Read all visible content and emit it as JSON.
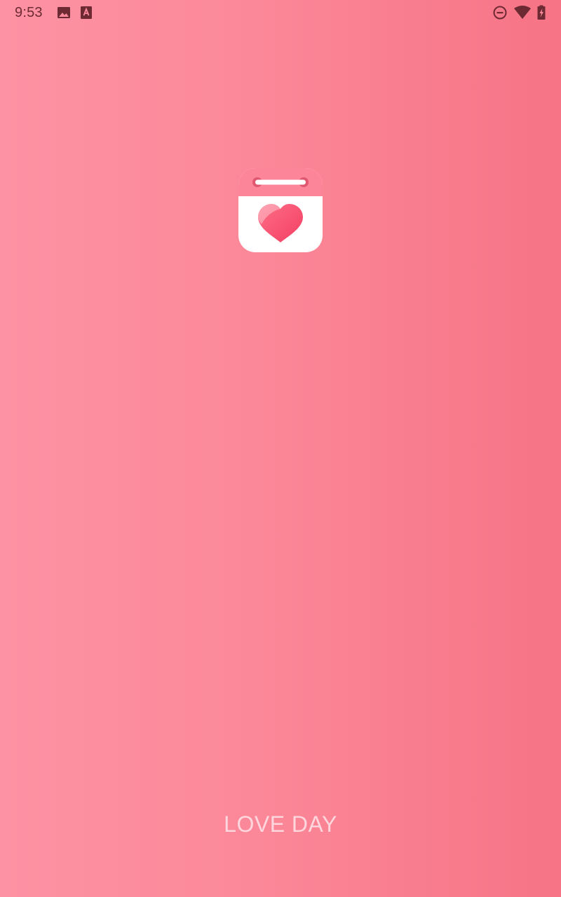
{
  "status_bar": {
    "time": "9:53",
    "left_icons": [
      "image-icon",
      "text-a-icon"
    ],
    "right_icons": [
      "do-not-disturb-icon",
      "wifi-icon",
      "battery-charging-icon"
    ]
  },
  "splash": {
    "logo_icon": "calendar-heart-icon",
    "app_name": "LOVE DAY"
  },
  "colors": {
    "background_start": "#fd92a4",
    "background_end": "#f67486",
    "logo_top": "#fd8599",
    "heart": "#f84e6e",
    "status_icons": "#6d2a33"
  }
}
